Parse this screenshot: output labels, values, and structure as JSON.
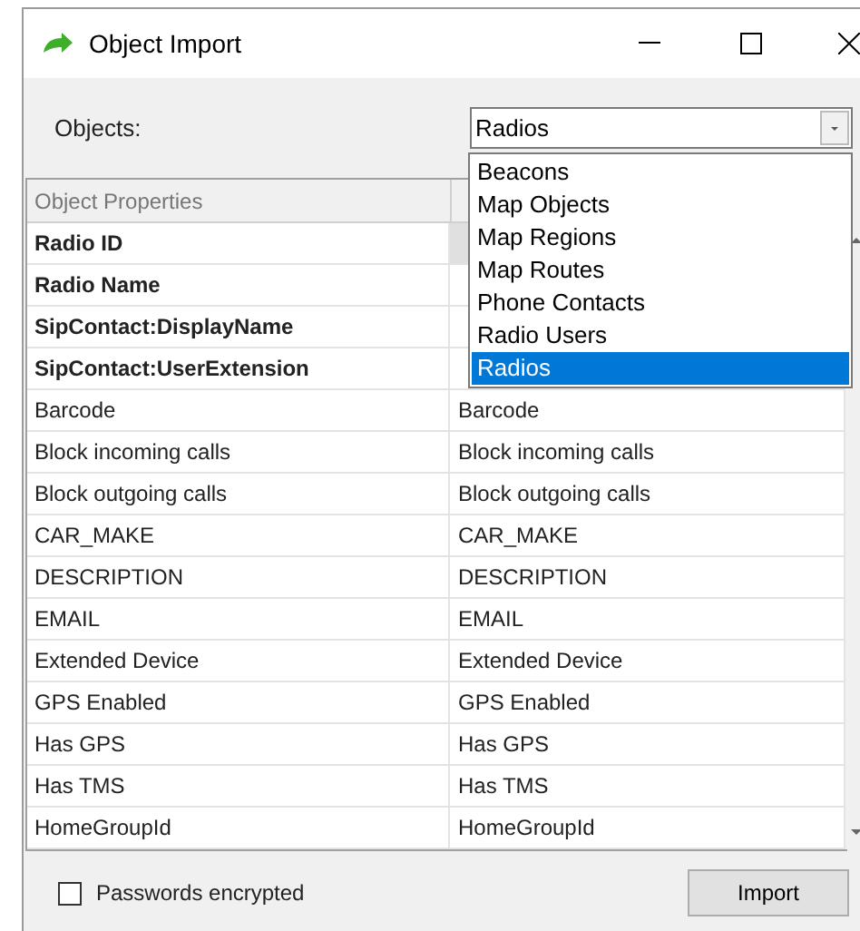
{
  "window": {
    "title": "Object Import"
  },
  "objects_label": "Objects:",
  "objects_combo": {
    "value": "Radios",
    "expanded": true,
    "options": [
      {
        "label": "Beacons",
        "selected": false
      },
      {
        "label": "Map Objects",
        "selected": false
      },
      {
        "label": "Map Regions",
        "selected": false
      },
      {
        "label": "Map Routes",
        "selected": false
      },
      {
        "label": "Phone Contacts",
        "selected": false
      },
      {
        "label": "Radio Users",
        "selected": false
      },
      {
        "label": "Radios",
        "selected": true
      }
    ]
  },
  "grid": {
    "columns": [
      "Object Properties"
    ],
    "rows": [
      {
        "property": "Radio ID",
        "required": true,
        "selected": true
      },
      {
        "property": "Radio Name",
        "required": true,
        "selected": false
      },
      {
        "property": "SipContact:DisplayName",
        "required": true,
        "selected": false
      },
      {
        "property": "SipContact:UserExtension",
        "required": true,
        "selected": false
      },
      {
        "property": "Barcode",
        "required": false,
        "selected": false,
        "mapped": "Barcode"
      },
      {
        "property": "Block incoming calls",
        "required": false,
        "selected": false,
        "mapped": "Block incoming calls"
      },
      {
        "property": "Block outgoing calls",
        "required": false,
        "selected": false,
        "mapped": "Block outgoing calls"
      },
      {
        "property": "CAR_MAKE",
        "required": false,
        "selected": false,
        "mapped": "CAR_MAKE"
      },
      {
        "property": "DESCRIPTION",
        "required": false,
        "selected": false,
        "mapped": "DESCRIPTION"
      },
      {
        "property": "EMAIL",
        "required": false,
        "selected": false,
        "mapped": "EMAIL"
      },
      {
        "property": "Extended Device",
        "required": false,
        "selected": false,
        "mapped": "Extended Device"
      },
      {
        "property": "GPS Enabled",
        "required": false,
        "selected": false,
        "mapped": "GPS Enabled"
      },
      {
        "property": "Has GPS",
        "required": false,
        "selected": false,
        "mapped": "Has GPS"
      },
      {
        "property": "Has TMS",
        "required": false,
        "selected": false,
        "mapped": "Has TMS"
      },
      {
        "property": "HomeGroupId",
        "required": false,
        "selected": false,
        "mapped": "HomeGroupId"
      }
    ]
  },
  "passwords_encrypted": {
    "label": "Passwords encrypted",
    "checked": false
  },
  "import_button": "Import"
}
